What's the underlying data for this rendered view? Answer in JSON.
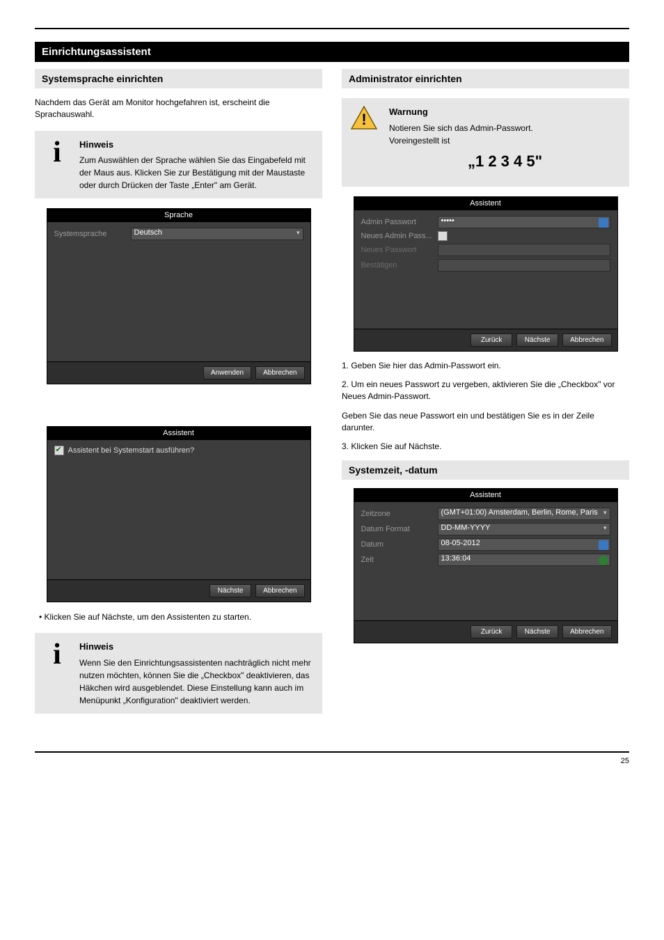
{
  "page": {
    "footer": "25",
    "section_bar": "Einrichtungsassistent",
    "left": {
      "heading": "Systemsprache einrichten",
      "intro": "Nachdem das Gerät am Monitor hochgefahren ist, erscheint die Sprachauswahl.",
      "note_title": "Hinweis",
      "info_icon": "i",
      "note_body": "Zum Auswählen der Sprache wählen Sie das Eingabefeld mit der Maus aus. Klicken Sie zur Bestätigung mit der Maustaste oder durch Drücken der Taste „Enter\" am Gerät.",
      "panel_lang": {
        "title": "Sprache",
        "label": "Systemsprache",
        "value": "Deutsch",
        "btn_apply": "Anwenden",
        "btn_cancel": "Abbrechen"
      },
      "panel_wizard": {
        "title": "Assistent",
        "checkbox_label": "Assistent bei Systemstart ausführen?",
        "btn_next": "Nächste",
        "btn_cancel": "Abbrechen"
      },
      "bullet": "Klicken Sie auf Nächste, um den Assistenten zu starten.",
      "note2_title": "Hinweis",
      "note2_body": "Wenn Sie den Einrichtungsassistenten nachträglich nicht mehr nutzen möchten, können Sie die „Checkbox\" deaktivieren, das Häkchen wird ausgeblendet. Diese Einstellung kann auch im Menüpunkt „Konfiguration\" deaktiviert werden."
    },
    "right": {
      "heading": "Administrator einrichten",
      "warn_title": "Warnung",
      "warn_body1": "Notieren Sie sich das Admin-Passwort.",
      "warn_body2": "Voreingestellt ist",
      "password_big": "„1 2 3 4 5\"",
      "panel_admin": {
        "title": "Assistent",
        "row1_label": "Admin Passwort",
        "row1_value": "•••••",
        "row2_label": "Neues Admin Pass...",
        "row3_label": "Neues Passwort",
        "row4_label": "Bestätigen",
        "btn_back": "Zurück",
        "btn_next": "Nächste",
        "btn_cancel": "Abbrechen"
      },
      "after_admin_1": "1. Geben Sie hier das Admin-Passwort ein.",
      "after_admin_2_pre": "2. Um ein neues Passwort zu vergeben, aktivieren Sie ",
      "after_admin_2_cb": "die „Checkbox\" vor",
      "after_admin_2_post": " Neues Admin-Passwort.",
      "after_admin_3": "Geben Sie das neue Passwort ein und bestätigen Sie es in der Zeile darunter.",
      "after_admin_4": "3. Klicken Sie auf Nächste.",
      "heading2": "Systemzeit, -datum",
      "panel_time": {
        "title": "Assistent",
        "row1_label": "Zeitzone",
        "row1_value": "(GMT+01:00) Amsterdam, Berlin, Rome, Paris",
        "row2_label": "Datum Format",
        "row2_value": "DD-MM-YYYY",
        "row3_label": "Datum",
        "row3_value": "08-05-2012",
        "row4_label": "Zeit",
        "row4_value": "13:36:04",
        "btn_back": "Zurück",
        "btn_next": "Nächste",
        "btn_cancel": "Abbrechen"
      }
    }
  }
}
